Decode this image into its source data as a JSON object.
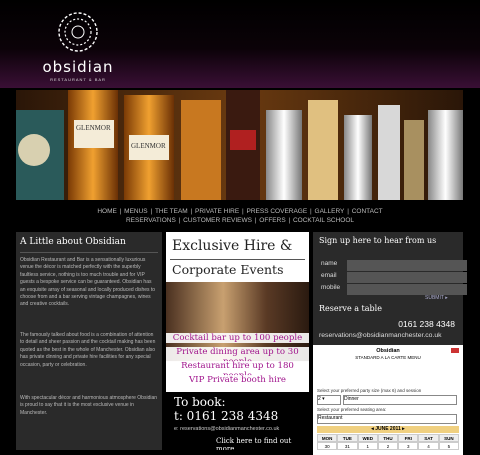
{
  "brand": {
    "name": "obsidian",
    "tagline": "RESTAURANT & BAR"
  },
  "nav": {
    "row1": [
      "HOME",
      "MENUS",
      "THE TEAM",
      "PRIVATE HIRE",
      "PRESS COVERAGE",
      "GALLERY",
      "CONTACT"
    ],
    "row2": [
      "RESERVATIONS",
      "CUSTOMER REVIEWS",
      "OFFERS",
      "COCKTAIL SCHOOL"
    ]
  },
  "about": {
    "title": "A Little about Obsidian",
    "p1": "Obsidian Restaurant and Bar is a sensationally luxurious venue the décor is matched perfectly with the superbly faultless service, nothing is too much trouble and for VIP guests a bespoke service can be guaranteed. Obsidian has an exquisite array of seasonal and locally produced dishes to choose from and a bar serving vintage champagnes, wines and creative cocktails.",
    "p2": "The famously talked about food is a combination of attention to detail and sheer passion and the cocktail making has been quoted as the best in the whole of Manchester. Obsidian also has private dinning and private hire facilities for any special occasion, party or celebration.",
    "p3": "With spectacular décor and harmonious atmosphere Obsidian is proud to say that it is the most exclusive venue in Manchester."
  },
  "hire": {
    "title1": "Exclusive Hire &",
    "title2": "Corporate Events",
    "items": [
      "Cocktail bar up to 100 people",
      "Private dining area up to 30 people",
      "Restaurant hire up to 180 people",
      "VIP Private booth hire"
    ],
    "book_label": "To book:",
    "book_phone": "t: 0161 238 4348",
    "book_email": "e: reservations@obsidianmanchester.co.uk",
    "find_more": "Click here to find out more"
  },
  "signup": {
    "title": "Sign up here to hear from us",
    "fields": [
      "name",
      "email",
      "mobile"
    ],
    "submit": "SUBMIT ▸",
    "reserve_title": "Reserve a table",
    "phone": "0161 238 4348",
    "email": "reservations@obsidianmanchester.co.uk"
  },
  "widget": {
    "name": "Obsidian",
    "menu": "STANDARD A LA CARTE MENU",
    "party_label": "Select your preferred party size (max 6) and session",
    "party_value": "2",
    "session_value": "Dinner",
    "area_label": "Select your preferred seating area:",
    "area_value": "Restaurant",
    "month": "JUNE 2011",
    "days": [
      "MON",
      "TUE",
      "WED",
      "THU",
      "FRI",
      "SAT",
      "SUN"
    ],
    "week1": [
      "30",
      "31",
      "1",
      "2",
      "3",
      "4",
      "5"
    ]
  },
  "colors": {
    "accent": "#a0148c",
    "bg": "#000000"
  }
}
